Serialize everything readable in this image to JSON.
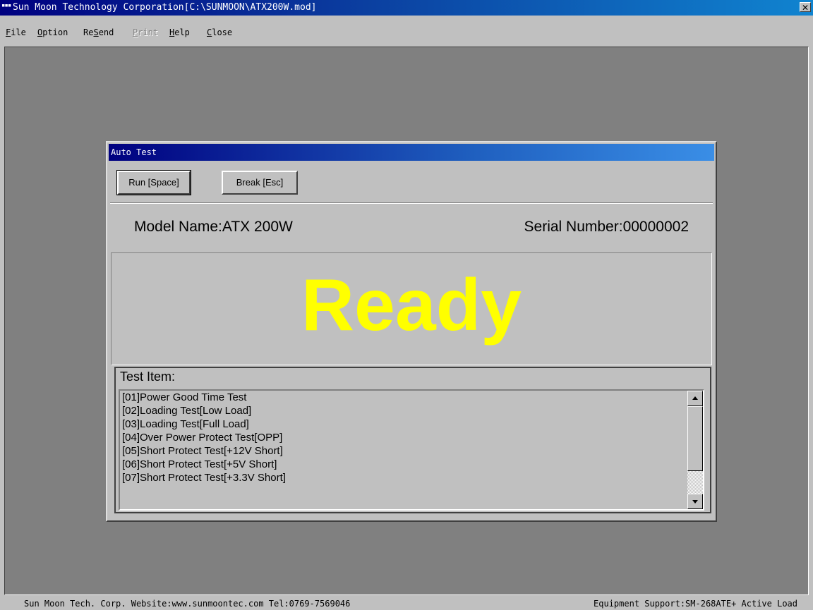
{
  "window": {
    "icon": "app-icon",
    "title": "Sun Moon Technology Corporation[C:\\SUNMOON\\ATX200W.mod]",
    "close_glyph": "✕"
  },
  "menu": {
    "file": {
      "acc": "F",
      "rest": "ile"
    },
    "option": {
      "acc": "O",
      "rest": "ption"
    },
    "resend": {
      "pre": "Re",
      "acc": "S",
      "rest": "end"
    },
    "print": {
      "acc": "P",
      "rest": "rint"
    },
    "help": {
      "acc": "H",
      "rest": "elp"
    },
    "close": {
      "acc": "C",
      "rest": "lose"
    }
  },
  "dialog": {
    "title": "Auto Test",
    "run_button": "Run [Space]",
    "break_button": "Break [Esc]",
    "model_name": "Model Name:ATX 200W",
    "serial_number": "Serial Number:00000002",
    "status": "Ready",
    "status_color": "#ffff00",
    "test_item_label": "Test Item:",
    "test_items": [
      "[01]Power Good Time Test",
      "[02]Loading Test[Low Load]",
      "[03]Loading Test[Full Load]",
      "[04]Over Power Protect Test[OPP]",
      "[05]Short Protect Test[+12V Short]",
      "[06]Short Protect Test[+5V Short]",
      "[07]Short Protect Test[+3.3V Short]"
    ]
  },
  "statusbar": {
    "left": "Sun Moon Tech. Corp. Website:www.sunmoontec.com Tel:0769-7569046",
    "right": "Equipment Support:SM-268ATE+ Active Load"
  },
  "colors": {
    "titlebar_start": "#000080",
    "titlebar_end": "#1084d0",
    "client_bg": "#808080",
    "face": "#c0c0c0"
  }
}
